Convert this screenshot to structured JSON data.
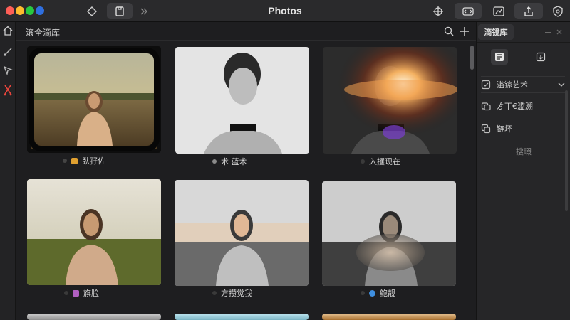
{
  "window": {
    "title": "Photos"
  },
  "collection": {
    "title": "滚全滴库"
  },
  "photos": [
    {
      "caption": "臥孖佐",
      "tag_color": "#e0a030",
      "dot_color": "#444444"
    },
    {
      "caption": "术 蓝术",
      "tag_color": "",
      "dot_color": "#8a8a8a"
    },
    {
      "caption": "入攫现在",
      "tag_color": "",
      "dot_color": "#3a3a3a"
    },
    {
      "caption": "旗脸",
      "tag_color": "#b060c0",
      "dot_color": "#3a3a3a"
    },
    {
      "caption": "方攒觉我",
      "tag_color": "",
      "dot_color": "#3a3a3a"
    },
    {
      "caption": "鲍靓",
      "tag_color": "#3f8fe0",
      "dot_color": "#3a3a3a"
    }
  ],
  "panel": {
    "tab_label": "滴镜库",
    "rows": [
      {
        "icon": "checkbox-icon",
        "label": "滥镓艺术"
      },
      {
        "icon": "layers-icon",
        "label": "ゟ丅€滥溯"
      },
      {
        "icon": "copy-icon",
        "label": "链坏"
      }
    ],
    "footer": "搜瑕"
  }
}
